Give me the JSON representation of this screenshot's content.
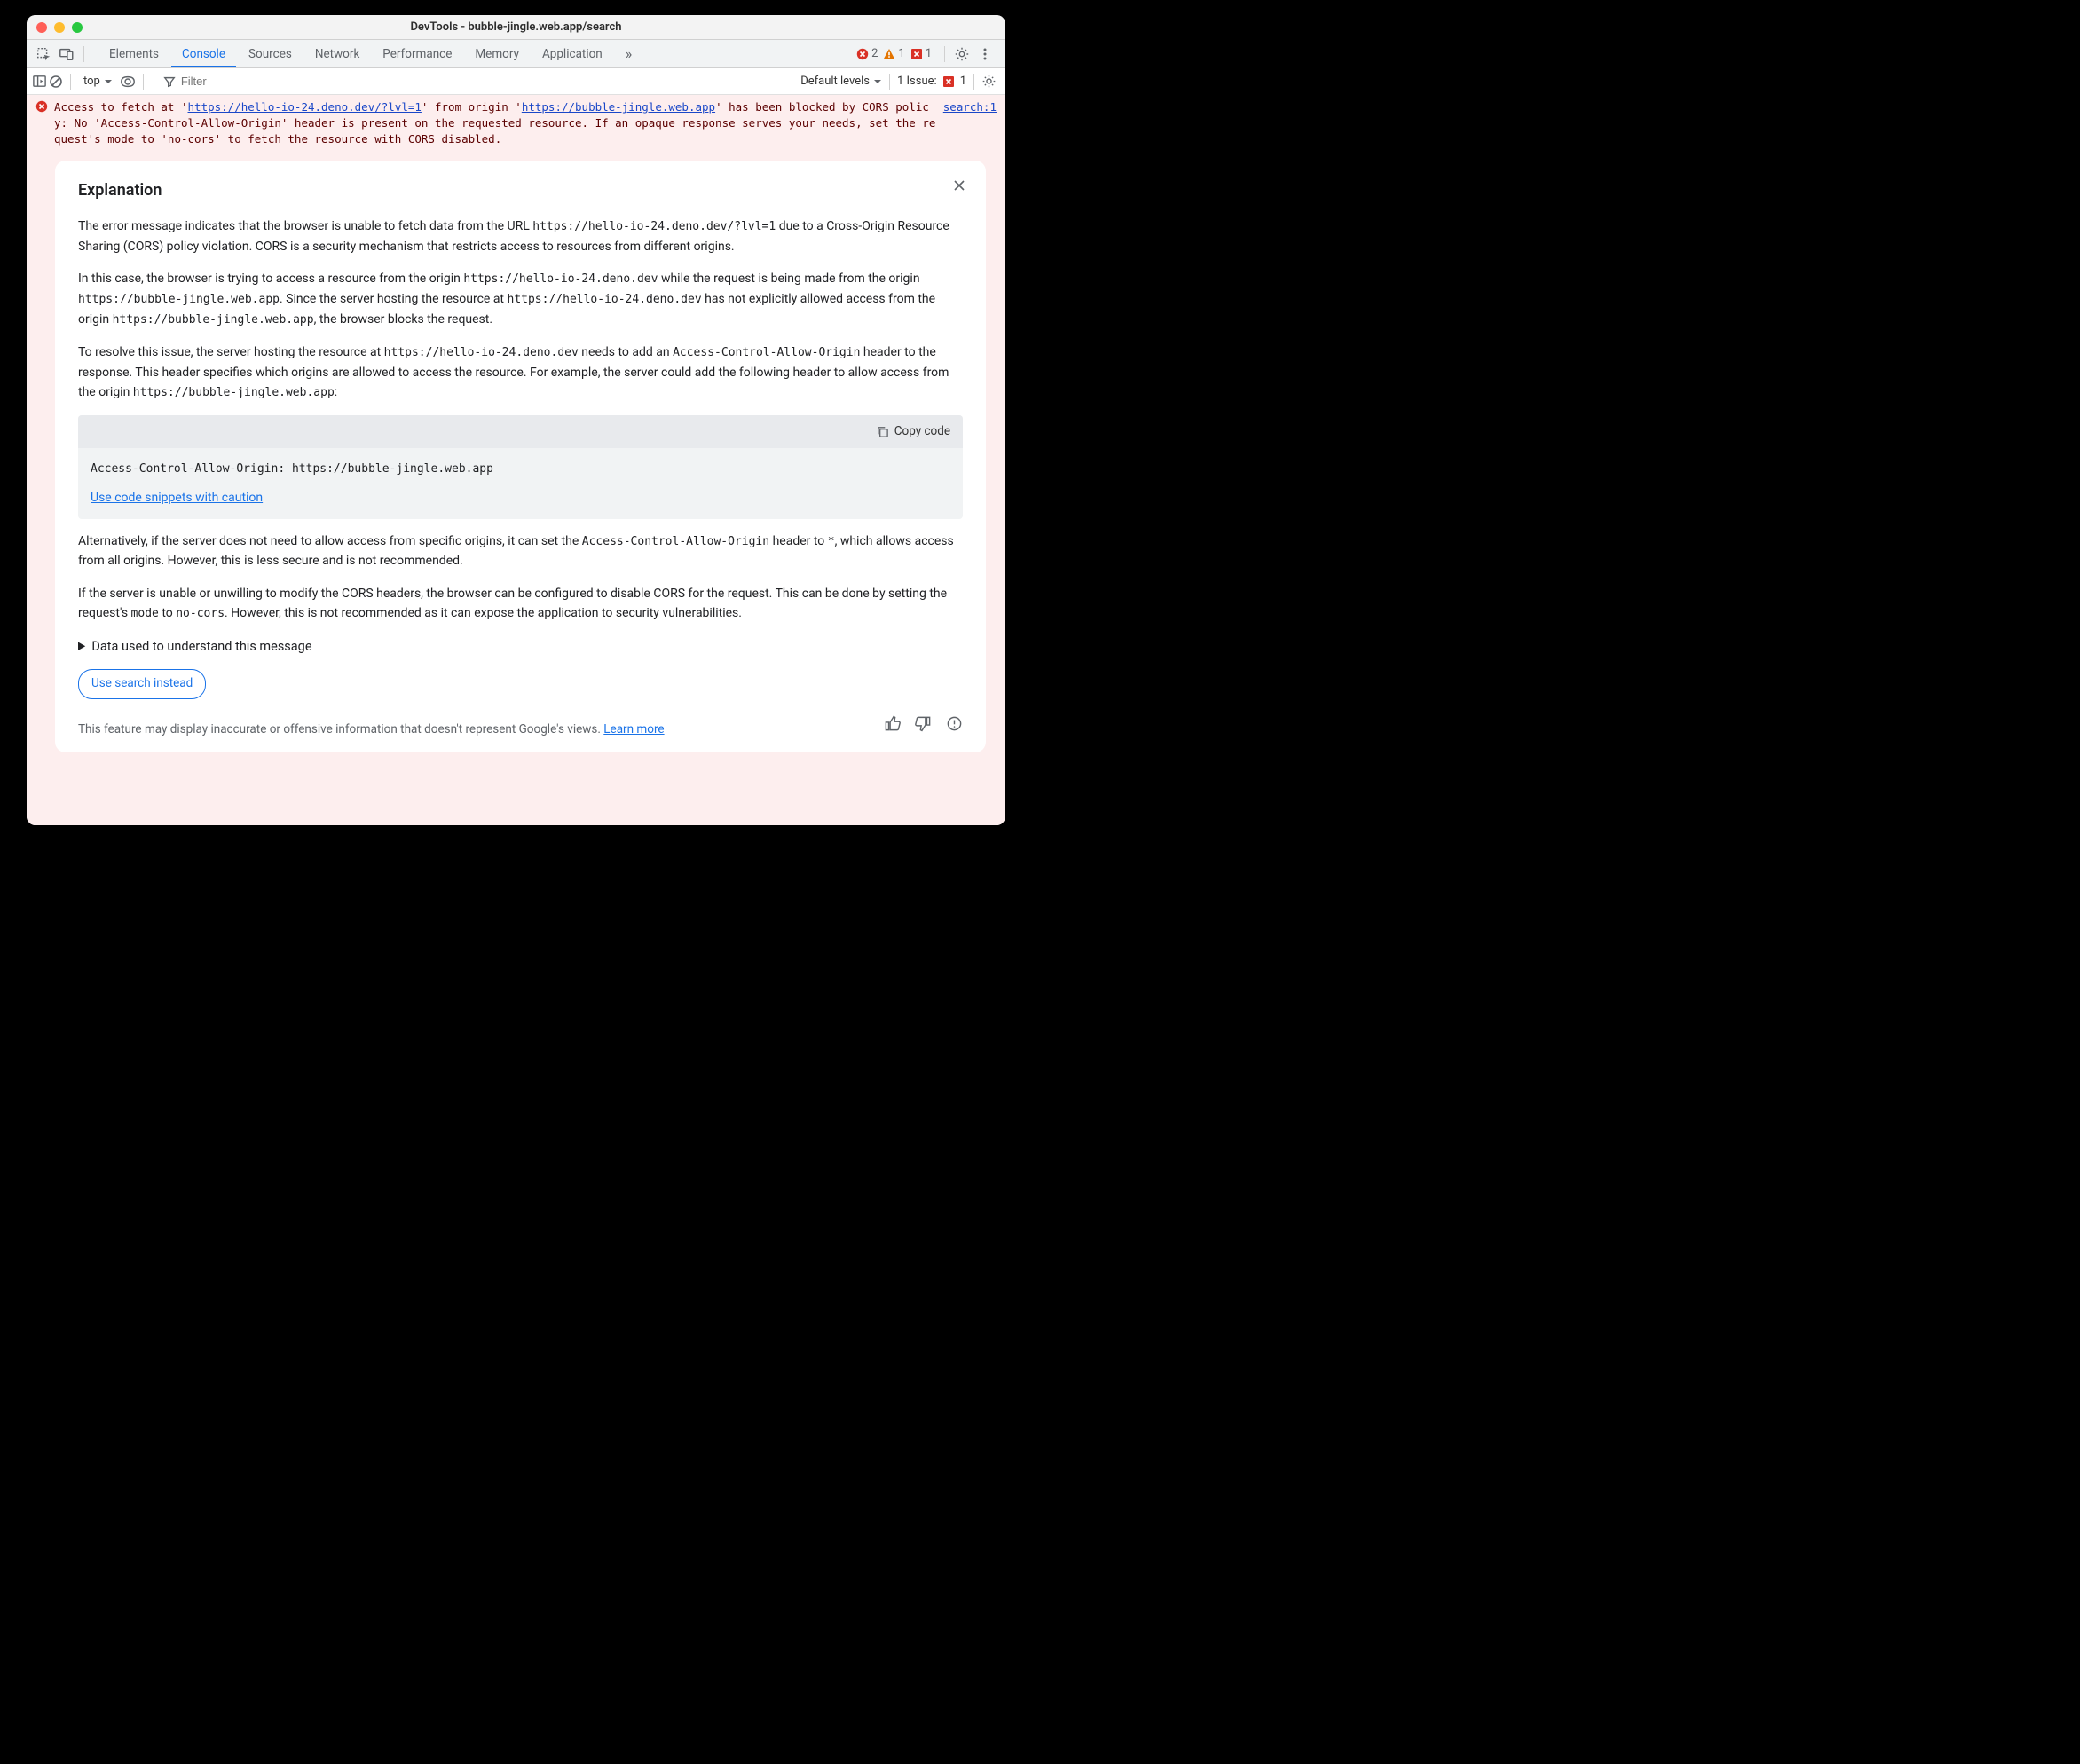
{
  "window": {
    "title": "DevTools - bubble-jingle.web.app/search"
  },
  "tabs": {
    "items": [
      "Elements",
      "Console",
      "Sources",
      "Network",
      "Performance",
      "Memory",
      "Application"
    ],
    "active": "Console"
  },
  "badges": {
    "error_count": "2",
    "warning_count": "1",
    "issue_red_count": "1"
  },
  "subbar": {
    "context": "top",
    "filter_placeholder": "Filter",
    "levels_label": "Default levels",
    "issues_label": "1 Issue:",
    "issue_count": "1"
  },
  "error": {
    "pre1": "Access to fetch at '",
    "url1": "https://hello-io-24.deno.dev/?lvl=1",
    "mid1": "' from origin '",
    "url2": "https://bubble-jingle.web.app",
    "post1": "' has been blocked by CORS policy: No 'Access-Control-Allow-Origin' header is present on the requested resource. If an opaque response serves your needs, set the request's mode to 'no-cors' to fetch the resource with CORS disabled.",
    "source": "search:1"
  },
  "explanation": {
    "heading": "Explanation",
    "p1_a": "The error message indicates that the browser is unable to fetch data from the URL ",
    "p1_code": "https://hello-io-24.deno.dev/?lvl=1",
    "p1_b": " due to a Cross-Origin Resource Sharing (CORS) policy violation. CORS is a security mechanism that restricts access to resources from different origins.",
    "p2_a": "In this case, the browser is trying to access a resource from the origin ",
    "p2_c1": "https://hello-io-24.deno.dev",
    "p2_b": " while the request is being made from the origin ",
    "p2_c2": "https://bubble-jingle.web.app",
    "p2_c": ". Since the server hosting the resource at ",
    "p2_c3": "https://hello-io-24.deno.dev",
    "p2_d": " has not explicitly allowed access from the origin ",
    "p2_c4": "https://bubble-jingle.web.app",
    "p2_e": ", the browser blocks the request.",
    "p3_a": "To resolve this issue, the server hosting the resource at ",
    "p3_c1": "https://hello-io-24.deno.dev",
    "p3_b": " needs to add an ",
    "p3_c2": "Access-Control-Allow-Origin",
    "p3_c": " header to the response. This header specifies which origins are allowed to access the resource. For example, the server could add the following header to allow access from the origin ",
    "p3_c3": "https://bubble-jingle.web.app",
    "p3_d": ":",
    "code_copy": "Copy code",
    "code_text": "Access-Control-Allow-Origin: https://bubble-jingle.web.app",
    "caution_link": "Use code snippets with caution",
    "p4_a": "Alternatively, if the server does not need to allow access from specific origins, it can set the ",
    "p4_c1": "Access-Control-Allow-Origin",
    "p4_b": " header to ",
    "p4_c2": "*",
    "p4_c": ", which allows access from all origins. However, this is less secure and is not recommended.",
    "p5_a": "If the server is unable or unwilling to modify the CORS headers, the browser can be configured to disable CORS for the request. This can be done by setting the request's ",
    "p5_c1": "mode",
    "p5_b": " to ",
    "p5_c2": "no-cors",
    "p5_c": ". However, this is not recommended as it can expose the application to security vulnerabilities.",
    "details_label": "Data used to understand this message",
    "search_button": "Use search instead",
    "disclaimer_a": "This feature may display inaccurate or offensive information that doesn't represent Google's views. ",
    "learn_more": "Learn more"
  }
}
